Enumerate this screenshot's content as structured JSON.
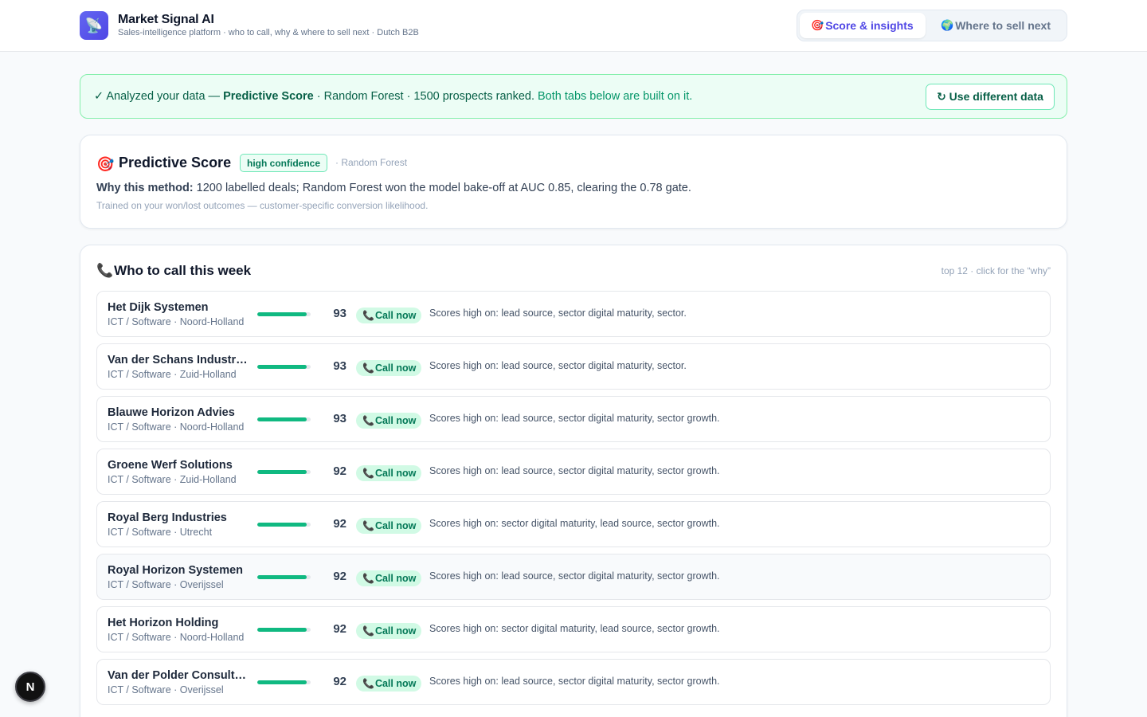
{
  "header": {
    "logo_icon": "satellite-dish-icon",
    "title": "Market Signal AI",
    "subtitle": "Sales-intelligence platform · who to call, why & where to sell next · Dutch B2B",
    "tabs": [
      {
        "icon": "🎯",
        "icon_name": "target-icon",
        "label": "Score & insights",
        "active": true
      },
      {
        "icon": "🌍",
        "icon_name": "globe-icon",
        "label": "Where to sell next",
        "active": false
      }
    ]
  },
  "banner": {
    "prefix": "✓ Analyzed your data — ",
    "method": "Predictive Score",
    "details": " · Random Forest · 1500 prospects ranked.",
    "note": " Both tabs below are built on it.",
    "button_label": "↻ Use different data"
  },
  "method_card": {
    "icon": "🎯",
    "title": "Predictive Score",
    "badge": "high confidence",
    "algorithm": "· Random Forest",
    "why_label": "Why this method:",
    "why_text": " 1200 labelled deals; Random Forest won the model bake-off at AUC 0.85, clearing the 0.78 gate.",
    "note": "Trained on your won/lost outcomes — customer-specific conversion likelihood."
  },
  "call_list": {
    "icon": "📞",
    "title": "Who to call this week",
    "meta": "top 12 · click for the “why”",
    "action_label": "Call now",
    "action_icon": "📞",
    "rows": [
      {
        "company": "Het Dijk Systemen",
        "meta": "ICT / Software · Noord-Holland",
        "score": 93,
        "reason": "Scores high on: lead source, sector digital maturity, sector."
      },
      {
        "company": "Van der Schans Industries",
        "meta": "ICT / Software · Zuid-Holland",
        "score": 93,
        "reason": "Scores high on: lead source, sector digital maturity, sector."
      },
      {
        "company": "Blauwe Horizon Advies",
        "meta": "ICT / Software · Noord-Holland",
        "score": 93,
        "reason": "Scores high on: lead source, sector digital maturity, sector growth."
      },
      {
        "company": "Groene Werf Solutions",
        "meta": "ICT / Software · Zuid-Holland",
        "score": 92,
        "reason": "Scores high on: lead source, sector digital maturity, sector growth."
      },
      {
        "company": "Royal Berg Industries",
        "meta": "ICT / Software · Utrecht",
        "score": 92,
        "reason": "Scores high on: sector digital maturity, lead source, sector growth."
      },
      {
        "company": "Royal Horizon Systemen",
        "meta": "ICT / Software · Overijssel",
        "score": 92,
        "reason": "Scores high on: lead source, sector digital maturity, sector growth."
      },
      {
        "company": "Het Horizon Holding",
        "meta": "ICT / Software · Noord-Holland",
        "score": 92,
        "reason": "Scores high on: sector digital maturity, lead source, sector growth."
      },
      {
        "company": "Van der Polder Consultancy",
        "meta": "ICT / Software · Overijssel",
        "score": 92,
        "reason": "Scores high on: lead source, sector digital maturity, sector growth."
      }
    ]
  },
  "dev_badge": {
    "letter": "N"
  },
  "colors": {
    "accent": "#4f46e5",
    "success": "#10b981",
    "success_text": "#047857",
    "banner_bg": "#ecfdf5"
  }
}
